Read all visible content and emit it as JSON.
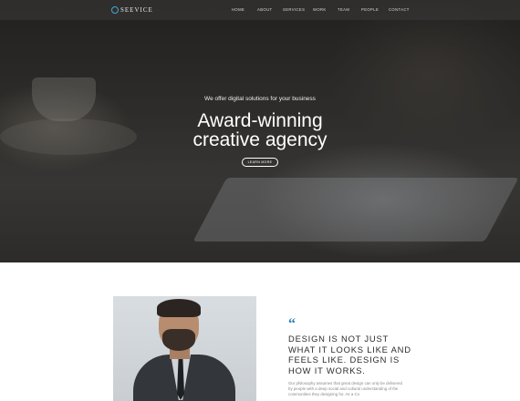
{
  "nav": {
    "logo_text": "SEEVICE",
    "items": [
      "HOME",
      "ABOUT",
      "SERVICES",
      "WORK",
      "TEAM",
      "PEOPLE",
      "CONTACT"
    ]
  },
  "hero": {
    "tagline": "We offer digital solutions for your business",
    "headline_line1": "Award-winning",
    "headline_line2": "creative agency",
    "cta_label": "LEARN MORE"
  },
  "about": {
    "quote_icon": "“",
    "quote_text": "DESIGN IS NOT JUST WHAT IT LOOKS LIKE AND FEELS LIKE. DESIGN IS HOW IT WORKS.",
    "body_text": "Our philosophy assumes that great design can only be delivered by people with a deep social and cultural understanding of the communities they designing for. As a Co"
  },
  "colors": {
    "accent": "#2a82b6",
    "logo_accent": "#3fa9d6"
  }
}
